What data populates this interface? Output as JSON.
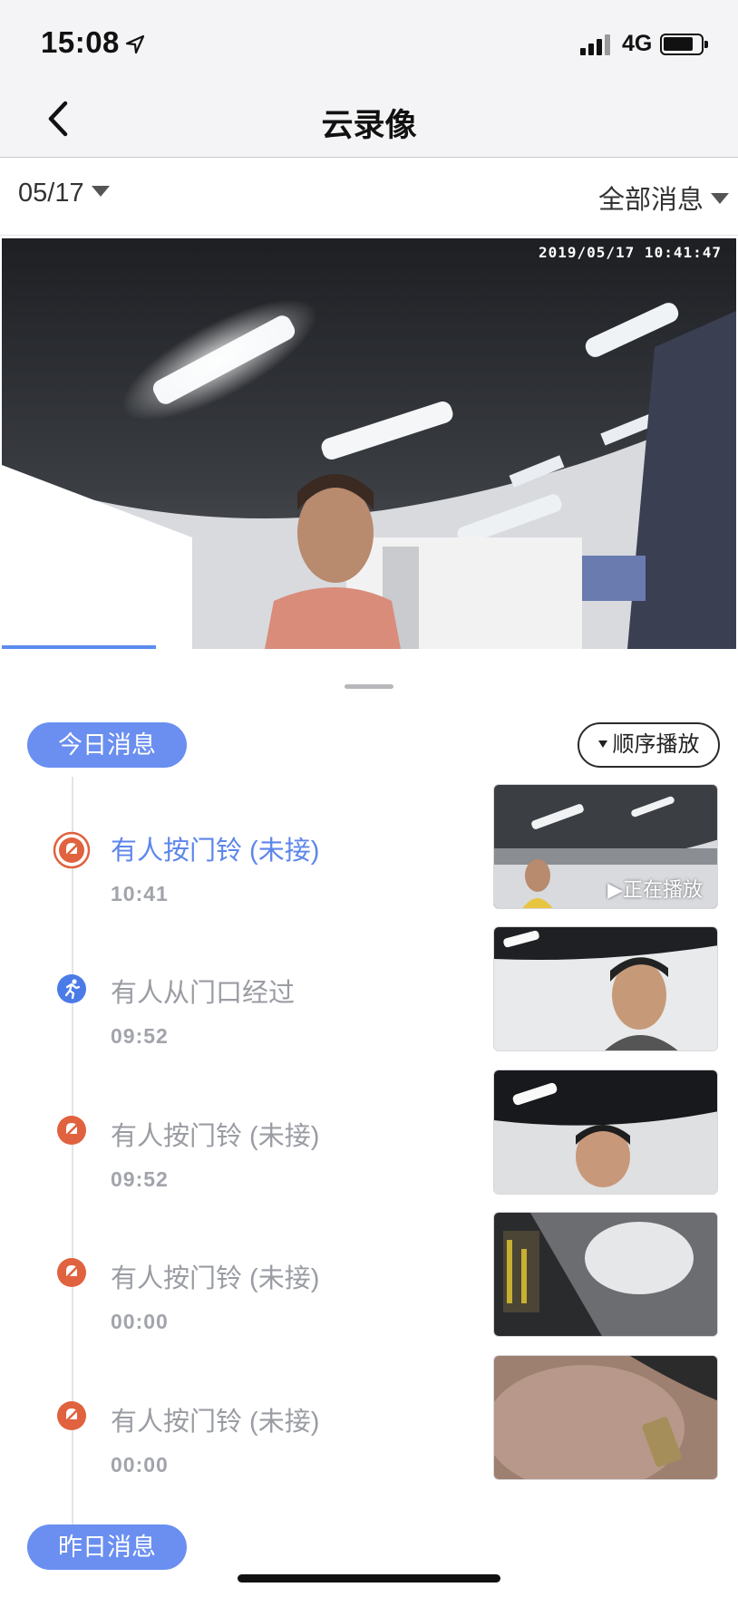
{
  "status_bar": {
    "time": "15:08",
    "network": "4G"
  },
  "nav": {
    "title": "云录像"
  },
  "filters": {
    "date": "05/17",
    "message_type": "全部消息"
  },
  "video": {
    "timestamp": "2019/05/17 10:41:47",
    "playback_progress": 0.21
  },
  "sections": {
    "today": {
      "label": "今日消息",
      "order_play": "顺序播放"
    },
    "yesterday": {
      "label": "昨日消息"
    }
  },
  "events": [
    {
      "title": "有人按门铃 (未接)",
      "time": "10:41",
      "type": "doorbell-missed",
      "active": true,
      "badge": "▶正在播放"
    },
    {
      "title": "有人从门口经过",
      "time": "09:52",
      "type": "motion",
      "active": false
    },
    {
      "title": "有人按门铃 (未接)",
      "time": "09:52",
      "type": "doorbell-missed",
      "active": false
    },
    {
      "title": "有人按门铃 (未接)",
      "time": "00:00",
      "type": "doorbell-missed",
      "active": false
    },
    {
      "title": "有人按门铃 (未接)",
      "time": "00:00",
      "type": "doorbell-missed",
      "active": false
    }
  ],
  "colors": {
    "accent": "#6a8ff0",
    "doorbell_icon": "#e0623e",
    "motion_icon": "#4b7be6"
  }
}
